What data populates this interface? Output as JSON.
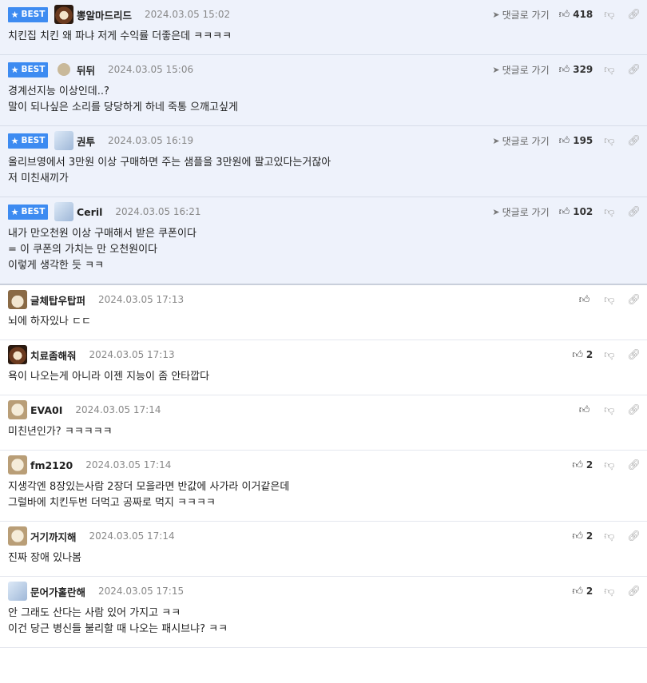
{
  "goto_label": "댓글로 가기",
  "best_label": "BEST",
  "colors": {
    "badge": "#3d8bf1",
    "best_bg": "#eef2fb"
  },
  "comments": [
    {
      "best": true,
      "nick": "뽕알마드리드",
      "date": "2024.03.05 15:02",
      "likes": "418",
      "avatar": "bear-face-avatar",
      "lines": [
        "치킨집 치킨 왜 파냐 저게 수익률 더좋은데 ㅋㅋㅋㅋ"
      ]
    },
    {
      "best": true,
      "nick": "뒤뒤",
      "date": "2024.03.05 15:06",
      "likes": "329",
      "avatar": "beige-dot-avatar",
      "lines": [
        "경계선지능 이상인데..?",
        "말이 되나싶은 소리를 당당하게 하네 죽통 으깨고싶게"
      ]
    },
    {
      "best": true,
      "nick": "권투",
      "date": "2024.03.05 16:19",
      "likes": "195",
      "avatar": "white-dog-avatar",
      "lines": [
        "올리브영에서 3만원 이상 구매하면 주는 샘플을 3만원에 팔고있다는거잖아",
        "저 미친새끼가"
      ]
    },
    {
      "best": true,
      "nick": "Ceril",
      "date": "2024.03.05 16:21",
      "likes": "102",
      "avatar": "white-dog-avatar",
      "lines": [
        "내가 만오천원 이상 구매해서 받은 쿠폰이다",
        "= 이 쿠폰의 가치는 만 오천원이다",
        "이렇게 생각한 듯 ㅋㅋ"
      ]
    },
    {
      "best": false,
      "nick": "글체탑우탑퍼",
      "date": "2024.03.05 17:13",
      "likes": "",
      "avatar": "chihuahua-avatar",
      "lines": [
        "뇌에 하자있나 ㄷㄷ"
      ]
    },
    {
      "best": false,
      "nick": "치료좀해줘",
      "date": "2024.03.05 17:13",
      "likes": "2",
      "avatar": "bear-face-avatar",
      "lines": [
        "욕이 나오는게 아니라 이젠 지능이 좀 안타깝다"
      ]
    },
    {
      "best": false,
      "nick": "EVA0I",
      "date": "2024.03.05 17:14",
      "likes": "",
      "avatar": "puppy-avatar",
      "lines": [
        "미친년인가? ㅋㅋㅋㅋㅋ"
      ]
    },
    {
      "best": false,
      "nick": "fm2120",
      "date": "2024.03.05 17:14",
      "likes": "2",
      "avatar": "puppy-avatar",
      "lines": [
        "지생각엔 8장있는사람 2장더 모을라면 반값에 사가라 이거같은데",
        "그럴바에 치킨두번 더먹고 공짜로 먹지 ㅋㅋㅋㅋ"
      ]
    },
    {
      "best": false,
      "nick": "거기까지해",
      "date": "2024.03.05 17:14",
      "likes": "2",
      "avatar": "puppy-avatar",
      "lines": [
        "진짜 장애 있나봄"
      ]
    },
    {
      "best": false,
      "nick": "문어가홀란해",
      "date": "2024.03.05 17:15",
      "likes": "2",
      "avatar": "white-dog-avatar",
      "lines": [
        "안 그래도 산다는 사람 있어 가지고 ㅋㅋ",
        "이건 당근 병신들 불리할 때 나오는 패시브냐? ㅋㅋ"
      ]
    }
  ]
}
